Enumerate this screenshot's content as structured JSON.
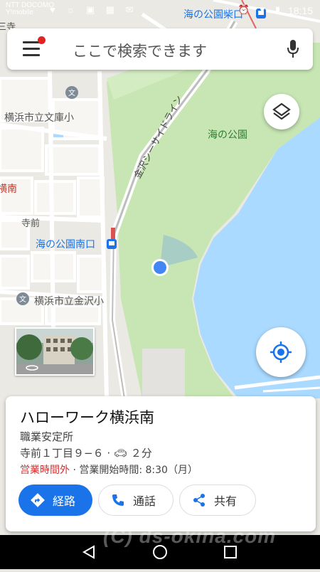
{
  "status_bar": {
    "carrier_line1": "NTT DOCOMO",
    "carrier_line2": "Y!mobile",
    "time": "18:15"
  },
  "search": {
    "placeholder": "ここで検索できます"
  },
  "map_labels": {
    "station_top": "海の公園柴口",
    "library": "横浜市立文庫小",
    "seaside_line": "金沢シーサイドライン",
    "park": "海の公園",
    "station_south": "海の公園南口",
    "teramae": "寺前",
    "school": "横浜市立金沢小",
    "partial_left_top": "三寺",
    "partial_left_red": "横南"
  },
  "place": {
    "name": "ハローワーク横浜南",
    "category": "職業安定所",
    "address": "寺前１丁目９−６",
    "drive_time": "２分",
    "hours_status": "営業時間外",
    "hours_text": "営業開始時間: 8:30（月）"
  },
  "actions": {
    "directions": "経路",
    "call": "通話",
    "share": "共有"
  },
  "watermark": "(C) ds-okina.com",
  "colors": {
    "accent": "#1a73e8",
    "closed": "#d32f2f",
    "water": "#aadaff",
    "park": "#c5e8b0"
  }
}
